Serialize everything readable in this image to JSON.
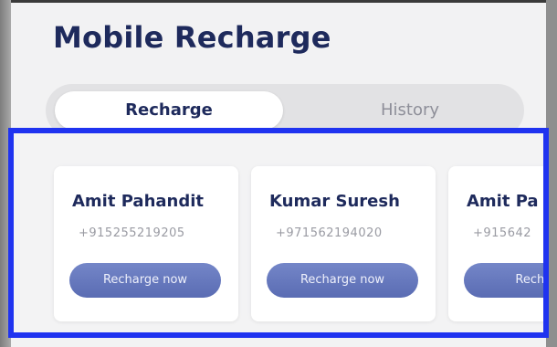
{
  "app": {
    "title": "Mobile Recharge"
  },
  "tabs": [
    {
      "label": "Recharge",
      "active": true
    },
    {
      "label": "History",
      "active": false
    }
  ],
  "contacts": [
    {
      "name": "Amit Pahandit",
      "phone": "+915255219205",
      "button": "Recharge now"
    },
    {
      "name": "Kumar Suresh",
      "phone": "+971562194020",
      "button": "Recharge now"
    },
    {
      "name": "Amit Pa",
      "phone": "+915642",
      "button": "Recharg"
    }
  ],
  "colors": {
    "title": "#1e2a5c",
    "button": "#6678bf",
    "highlight_frame": "#1f33f0"
  }
}
